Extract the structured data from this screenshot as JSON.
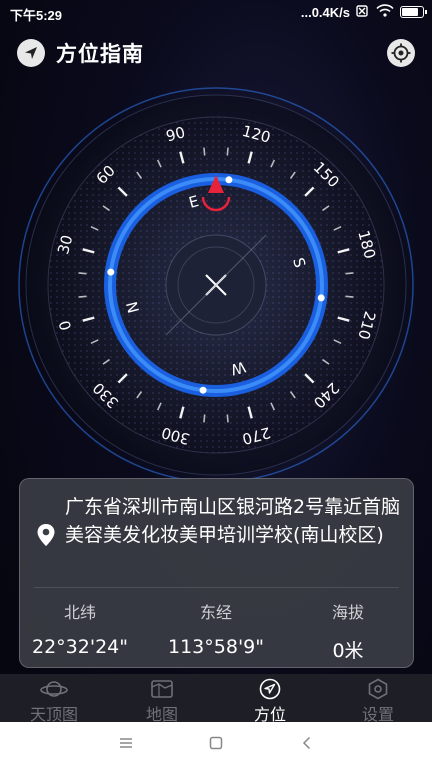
{
  "status_bar": {
    "time": "下午5:29",
    "network_speed": "...0.4K/s"
  },
  "header": {
    "title": "方位指南"
  },
  "compass": {
    "heading_degrees": 105,
    "ring_direction_labels": [
      "E",
      "S",
      "W",
      "N"
    ],
    "degree_labels": [
      "0",
      "30",
      "60",
      "90",
      "120",
      "150",
      "180",
      "210",
      "240",
      "270",
      "300",
      "330"
    ]
  },
  "location_card": {
    "address": "广东省深圳市南山区银河路2号靠近首脑美容美发化妆美甲培训学校(南山校区)",
    "latitude_label": "北纬",
    "latitude_value": "22°32'24\"",
    "longitude_label": "东经",
    "longitude_value": "113°58'9\"",
    "altitude_label": "海拔",
    "altitude_value": "0米"
  },
  "bottom_nav": {
    "items": [
      {
        "label": "天顶图",
        "icon": "planet-icon"
      },
      {
        "label": "地图",
        "icon": "map-icon"
      },
      {
        "label": "方位",
        "icon": "compass-icon"
      },
      {
        "label": "设置",
        "icon": "settings-icon"
      }
    ],
    "active_index": 2
  },
  "colors": {
    "accent_blue": "#2f7fff",
    "needle_red": "#e8223a",
    "nav_active": "#ffffff",
    "nav_inactive": "#6f7078"
  }
}
